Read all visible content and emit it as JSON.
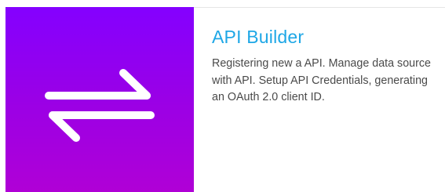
{
  "card": {
    "icon": "swap-arrows-icon",
    "title": "API Builder",
    "description": "Registering new a API. Manage data source with API. Setup API Credentials, generating an OAuth 2.0 client ID.",
    "colors": {
      "gradient_top": "#8400ff",
      "gradient_bottom": "#b000d6",
      "title": "#1ea7e6",
      "text": "#4a4a4a"
    }
  }
}
